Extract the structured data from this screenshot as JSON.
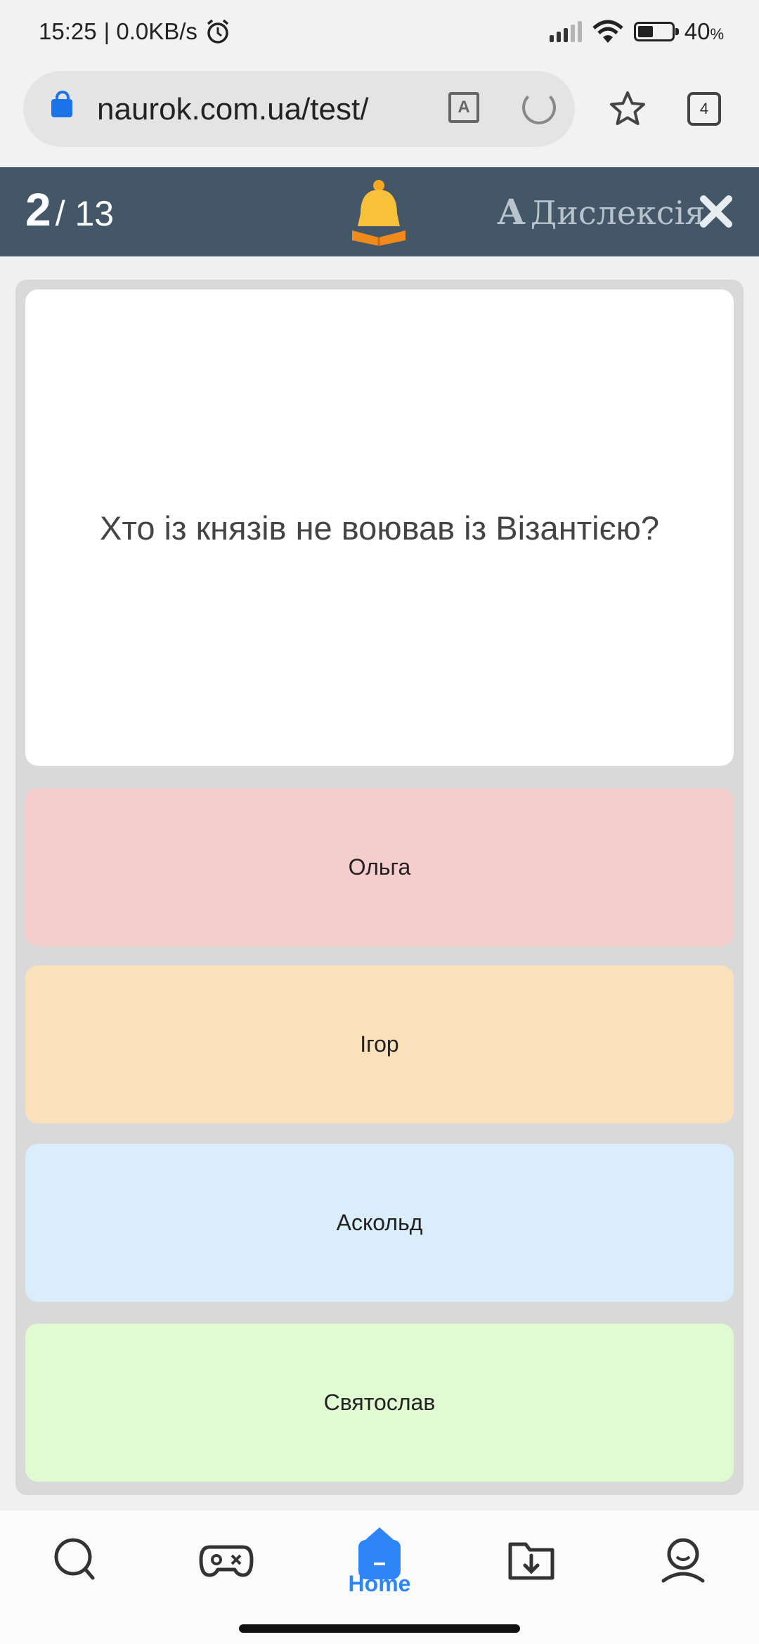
{
  "status_bar": {
    "time": "15:25",
    "network_speed": "| 0.0KB/s",
    "battery_percent": "40",
    "battery_unit": "%",
    "battery_level": 0.4
  },
  "browser": {
    "url": "naurok.com.ua/test/",
    "tab_count": "4"
  },
  "header": {
    "current_question": "2",
    "total_questions": "/ 13",
    "dyslexia_glyph": "A",
    "dyslexia_label": "Дислексія"
  },
  "question": {
    "text": "Хто із князів не воював із Візантією?"
  },
  "answers": [
    {
      "label": "Ольга",
      "color": "#f6cdcd"
    },
    {
      "label": "Ігор",
      "color": "#fae1bc"
    },
    {
      "label": "Аскольд",
      "color": "#d9eefa"
    },
    {
      "label": "Святослав",
      "color": "#e0fad2"
    }
  ],
  "bottom_nav": {
    "items": [
      {
        "icon": "search-icon"
      },
      {
        "icon": "gamepad-icon"
      },
      {
        "icon": "home-icon",
        "label": "Home"
      },
      {
        "icon": "download-folder-icon"
      },
      {
        "icon": "profile-icon"
      }
    ]
  },
  "colors": {
    "header_bg": "#435768",
    "accent_blue": "#2e86f6",
    "bell_orange": "#f7a823"
  }
}
